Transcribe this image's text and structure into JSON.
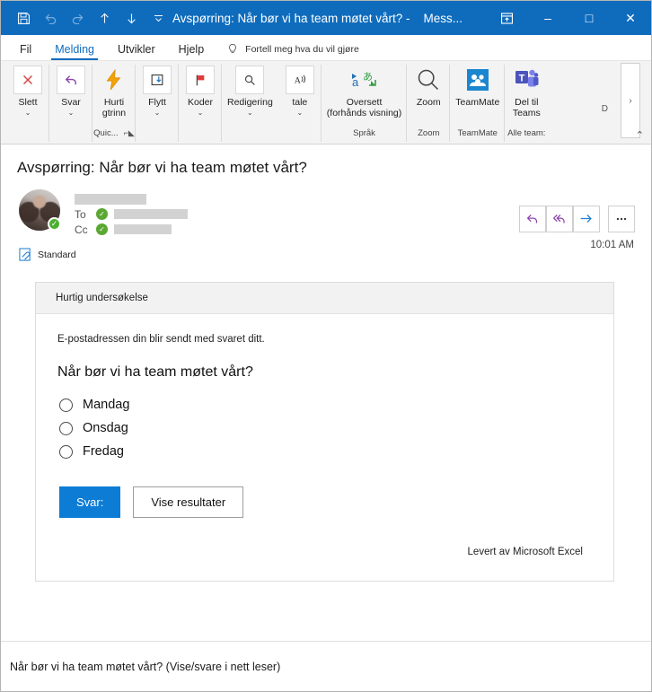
{
  "titlebar": {
    "quick_access": [
      {
        "name": "save-icon",
        "glyph": "save"
      },
      {
        "name": "undo-icon",
        "glyph": "undo"
      },
      {
        "name": "redo-icon",
        "glyph": "redo"
      },
      {
        "name": "previous-item-icon",
        "glyph": "up"
      },
      {
        "name": "next-item-icon",
        "glyph": "down"
      },
      {
        "name": "customize-quick-access-icon",
        "glyph": "chevron-down"
      }
    ],
    "title": "Avspørring: Når bør vi ha team møtet vårt? -",
    "app_name": "Mess...",
    "ribbon_display_options": "ribbon-display-options-icon",
    "minimize": "–",
    "maximize": "□",
    "close": "✕",
    "bg_color": "#0f6cbd"
  },
  "tabs": {
    "items": [
      {
        "label": "Fil",
        "active": false
      },
      {
        "label": "Melding",
        "active": true
      },
      {
        "label": "Utvikler",
        "active": false
      },
      {
        "label": "Hjelp",
        "active": false
      }
    ],
    "tell_me": "Fortell meg hva du vil gjøre",
    "accent_color": "#0f6cbd"
  },
  "ribbon": {
    "groups": [
      {
        "label": "",
        "label_extra": "",
        "buttons": [
          {
            "caption": "Slett",
            "caption2": "",
            "icon": "delete-icon",
            "has_caret": true
          }
        ]
      },
      {
        "label": "",
        "label_extra": "",
        "buttons": [
          {
            "caption": "Svar",
            "caption2": "",
            "icon": "reply-icon",
            "has_caret": true
          }
        ]
      },
      {
        "label": "Quic...",
        "label_extra": "dialog-launcher",
        "buttons": [
          {
            "caption": "Hurti",
            "caption2": "gtrinn",
            "icon": "quick-steps-icon",
            "has_caret": false
          }
        ]
      },
      {
        "label": "",
        "label_extra": "",
        "buttons": [
          {
            "caption": "Flytt",
            "caption2": "",
            "icon": "move-icon",
            "has_caret": true
          }
        ]
      },
      {
        "label": "",
        "label_extra": "",
        "buttons": [
          {
            "caption": "Koder",
            "caption2": "",
            "icon": "tags-flag-icon",
            "has_caret": true
          }
        ]
      },
      {
        "label": "",
        "label_extra": "",
        "buttons": [
          {
            "caption": "Redigering",
            "caption2": "",
            "icon": "editing-search-icon",
            "has_caret": true
          },
          {
            "caption": "tale",
            "caption2": "",
            "icon": "speech-read-aloud-icon",
            "has_caret": true
          }
        ]
      },
      {
        "label": "Språk",
        "label_extra": "",
        "buttons": [
          {
            "caption": "Oversett",
            "caption2": "(forhånds visning)",
            "icon": "translate-icon",
            "has_caret": false
          }
        ]
      },
      {
        "label": "Zoom",
        "label_extra": "",
        "buttons": [
          {
            "caption": "Zoom",
            "caption2": "",
            "icon": "zoom-magnifier-icon",
            "has_caret": false
          }
        ]
      },
      {
        "label": "TeamMate",
        "label_extra": "",
        "buttons": [
          {
            "caption": "TeamMate",
            "caption2": "",
            "icon": "teammate-people-icon",
            "has_caret": false
          }
        ]
      },
      {
        "label": "Alle team:",
        "label_extra": "",
        "buttons": [
          {
            "caption": "Del til",
            "caption2": "Teams",
            "icon": "microsoft-teams-icon",
            "has_caret": false
          }
        ]
      }
    ],
    "overflow_label": "D",
    "overflow_chevron": "›",
    "collapse_ribbon": "⌃"
  },
  "message": {
    "subject": "Avspørring: Når bør vi ha team møtet vårt?",
    "sender_redacted": true,
    "to_label": "To",
    "cc_label": "Cc",
    "timestamp": "10:01 AM",
    "actions": [
      {
        "name": "reply-button",
        "glyph": "reply"
      },
      {
        "name": "reply-all-button",
        "glyph": "reply-all"
      },
      {
        "name": "forward-button",
        "glyph": "forward"
      },
      {
        "name": "more-actions-button",
        "glyph": "ellipsis"
      }
    ],
    "attachment": {
      "name": "Standard",
      "icon": "attachment-icon"
    }
  },
  "survey": {
    "header": "Hurtig undersøkelse",
    "note": "E-postadressen din blir sendt med svaret ditt.",
    "question": "Når bør vi ha team møtet vårt?",
    "options": [
      {
        "label": "Mandag",
        "selected": false
      },
      {
        "label": "Onsdag",
        "selected": false
      },
      {
        "label": "Fredag",
        "selected": false
      }
    ],
    "submit_label": "Svar:",
    "results_label": "Vise resultater",
    "footer": "Levert av Microsoft Excel",
    "primary_color": "#0c7cd5"
  },
  "statusbar": {
    "text": "Når bør vi ha team møtet vårt? (Vise/svare i nett leser)"
  }
}
